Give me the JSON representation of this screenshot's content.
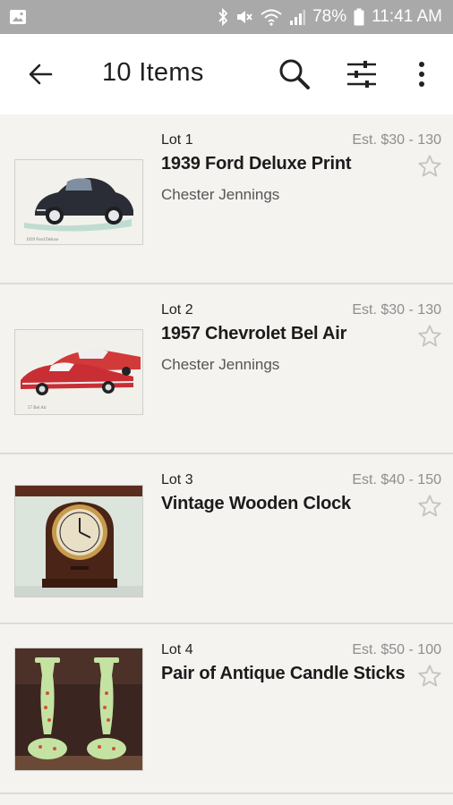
{
  "status_bar": {
    "battery_text": "78%",
    "time": "11:41 AM",
    "icons": [
      "gallery-icon",
      "bluetooth-icon",
      "mute-icon",
      "wifi-icon",
      "signal-icon",
      "battery-icon"
    ]
  },
  "app_bar": {
    "title": "10 Items",
    "icons": [
      "back-arrow-icon",
      "search-icon",
      "filter-sliders-icon",
      "more-vert-icon"
    ]
  },
  "lots": [
    {
      "lot": "Lot 1",
      "estimate": "Est. $30 - 130",
      "title": "1939 Ford Deluxe Print",
      "artist": "Chester Jennings",
      "image": "black-vintage-car-painting"
    },
    {
      "lot": "Lot 2",
      "estimate": "Est. $30 - 130",
      "title": "1957 Chevrolet Bel Air",
      "artist": "Chester Jennings",
      "image": "red-classic-cars-painting"
    },
    {
      "lot": "Lot 3",
      "estimate": "Est. $40 - 150",
      "title": "Vintage Wooden Clock",
      "artist": "",
      "image": "wooden-mantel-clock-photo"
    },
    {
      "lot": "Lot 4",
      "estimate": "Est. $50 - 100",
      "title": "Pair of Antique Candle Sticks",
      "artist": "",
      "image": "green-candlesticks-photo"
    }
  ],
  "colors": {
    "status_bar": "#a9a9a9",
    "app_bar": "#ffffff",
    "list_bg": "#f4f3f0",
    "estimate_text": "#8e8e8e",
    "star_outline": "#c4c4c4"
  }
}
